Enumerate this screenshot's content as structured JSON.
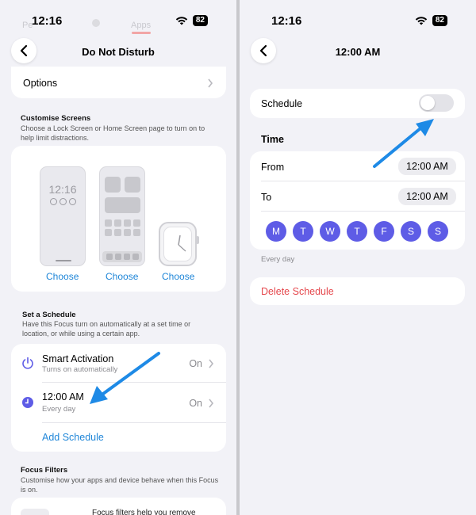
{
  "left": {
    "status_time": "12:16",
    "battery": "82",
    "ghost_left": "Pe",
    "ghost_right": "Apps",
    "nav_title": "Do Not Disturb",
    "options_label": "Options",
    "customise_title": "Customise Screens",
    "customise_desc": "Choose a Lock Screen or Home Screen page to turn on to help limit distractions.",
    "lock_time": "12:16",
    "choose_1": "Choose",
    "choose_2": "Choose",
    "choose_3": "Choose",
    "schedule_title": "Set a Schedule",
    "schedule_desc": "Have this Focus turn on automatically at a set time or location, or while using a certain app.",
    "smart_title": "Smart Activation",
    "smart_sub": "Turns on automatically",
    "smart_value": "On",
    "time_title": "12:00 AM",
    "time_sub": "Every day",
    "time_value": "On",
    "add_schedule": "Add Schedule",
    "filters_title": "Focus Filters",
    "filters_desc": "Customise how your apps and device behave when this Focus is on.",
    "filters_card_text": "Focus filters help you remove"
  },
  "right": {
    "status_time": "12:16",
    "battery": "82",
    "nav_title": "12:00 AM",
    "schedule_label": "Schedule",
    "time_header": "Time",
    "from_label": "From",
    "from_value": "12:00 AM",
    "to_label": "To",
    "to_value": "12:00 AM",
    "days": [
      "M",
      "T",
      "W",
      "T",
      "F",
      "S",
      "S"
    ],
    "repeat_caption": "Every day",
    "delete_label": "Delete Schedule"
  },
  "colors": {
    "accent_blue": "#1f86d8",
    "day_purple": "#5e5ce6",
    "delete_red": "#e5484d",
    "arrow_blue": "#1e8ae6"
  }
}
